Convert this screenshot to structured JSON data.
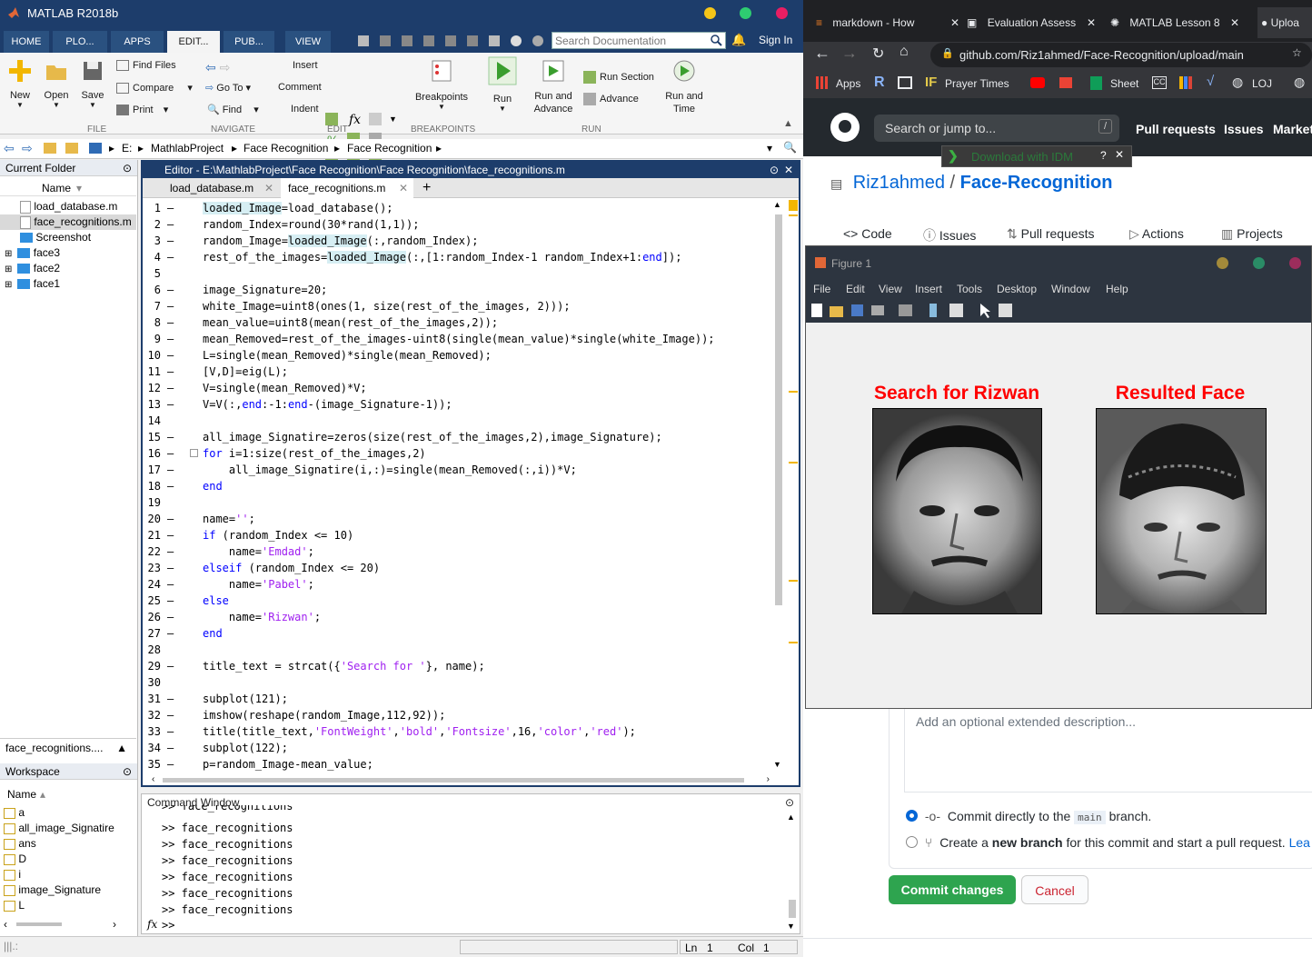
{
  "matlab": {
    "title": "MATLAB R2018b",
    "tabs": [
      "HOME",
      "PLO...",
      "APPS",
      "EDIT...",
      "PUB...",
      "VIEW"
    ],
    "search_placeholder": "Search Documentation",
    "sign_in": "Sign In",
    "ribbon": {
      "new": "New",
      "open": "Open",
      "save": "Save",
      "find_files": "Find Files",
      "compare": "Compare",
      "print": "Print",
      "go_to": "Go To",
      "find": "Find",
      "insert": "Insert",
      "comment": "Comment",
      "indent": "Indent",
      "breakpoints": "Breakpoints",
      "run": "Run",
      "run_and_advance": "Run and Advance",
      "run_section": "Run Section",
      "advance": "Advance",
      "run_and_time": "Run and Time",
      "sections": [
        "FILE",
        "NAVIGATE",
        "EDIT",
        "BREAKPOINTS",
        "RUN"
      ]
    },
    "address": [
      "E:",
      "MathlabProject",
      "Face Recognition",
      "Face Recognition"
    ],
    "current_folder": {
      "title": "Current Folder",
      "column": "Name",
      "items": [
        "load_database.m",
        "face_recognitions.m",
        "Screenshot",
        "face3",
        "face2",
        "face1"
      ],
      "footer": "face_recognitions...."
    },
    "workspace": {
      "title": "Workspace",
      "column": "Name",
      "items": [
        "a",
        "all_image_Signatire",
        "ans",
        "D",
        "i",
        "image_Signature",
        "L"
      ]
    },
    "editor": {
      "title": "Editor - E:\\MathlabProject\\Face Recognition\\Face Recognition\\face_recognitions.m",
      "tabs": [
        "load_database.m",
        "face_recognitions.m"
      ],
      "add_tab": "+"
    },
    "command_window": {
      "title": "Command Window",
      "partial_line": ">>  face_recognitions",
      "history": [
        ">> face_recognitions",
        ">> face_recognitions",
        ">> face_recognitions",
        ">> face_recognitions",
        ">> face_recognitions",
        ">> face_recognitions"
      ],
      "prompt": ">>",
      "fx": "fx"
    },
    "status": {
      "ln_label": "Ln",
      "ln": "1",
      "col_label": "Col",
      "col": "1"
    }
  },
  "chrome": {
    "tabs": [
      "markdown - How",
      "Evaluation Assess",
      "MATLAB Lesson 8",
      "Uploa"
    ],
    "url": "github.com/Riz1ahmed/Face-Recognition/upload/main",
    "bookmarks": [
      "Apps",
      "Prayer Times",
      "Sheet",
      "LOJ"
    ],
    "idm": "Download with IDM",
    "github": {
      "search_placeholder": "Search or jump to...",
      "slash": "/",
      "nav": [
        "Pull requests",
        "Issues",
        "Market"
      ],
      "owner": "Riz1ahmed",
      "sep": "/",
      "repo": "Face-Recognition",
      "repo_tabs": [
        "Code",
        "Issues",
        "Pull requests",
        "Actions",
        "Projects"
      ],
      "desc_placeholder": "Add an optional extended description...",
      "commit_direct_pre": "Commit directly to the",
      "branch": "main",
      "commit_direct_post": "branch.",
      "new_branch_pre": "Create a",
      "new_branch_bold": "new branch",
      "new_branch_post": "for this commit and start a pull request.",
      "learn": "Lea",
      "commit_button": "Commit changes",
      "cancel_button": "Cancel"
    }
  },
  "figure": {
    "title": "Figure 1",
    "menu": [
      "File",
      "Edit",
      "View",
      "Insert",
      "Tools",
      "Desktop",
      "Window",
      "Help"
    ],
    "left_title": "Search for Rizwan",
    "right_title": "Resulted Face",
    "title_color": "#ff0000"
  },
  "code_lines": [
    {
      "n": "1",
      "d": "–",
      "t": "loaded_Image=load_database();"
    },
    {
      "n": "2",
      "d": "–",
      "t": "random_Index=round(30*rand(1,1));"
    },
    {
      "n": "3",
      "d": "–",
      "t": "random_Image=loaded_Image(:,random_Index);"
    },
    {
      "n": "4",
      "d": "–",
      "t": "rest_of_the_images=loaded_Image(:,[1:random_Index-1 random_Index+1:end]);"
    },
    {
      "n": "5",
      "d": "",
      "t": ""
    },
    {
      "n": "6",
      "d": "–",
      "t": "image_Signature=20;"
    },
    {
      "n": "7",
      "d": "–",
      "t": "white_Image=uint8(ones(1, size(rest_of_the_images, 2)));"
    },
    {
      "n": "8",
      "d": "–",
      "t": "mean_value=uint8(mean(rest_of_the_images,2));"
    },
    {
      "n": "9",
      "d": "–",
      "t": "mean_Removed=rest_of_the_images-uint8(single(mean_value)*single(white_Image));"
    },
    {
      "n": "10",
      "d": "–",
      "t": "L=single(mean_Removed)'*single(mean_Removed);"
    },
    {
      "n": "11",
      "d": "–",
      "t": "[V,D]=eig(L);"
    },
    {
      "n": "12",
      "d": "–",
      "t": "V=single(mean_Removed)*V;"
    },
    {
      "n": "13",
      "d": "–",
      "t": "V=V(:,end:-1:end-(image_Signature-1));"
    },
    {
      "n": "14",
      "d": "",
      "t": ""
    },
    {
      "n": "15",
      "d": "–",
      "t": "all_image_Signatire=zeros(size(rest_of_the_images,2),image_Signature);"
    },
    {
      "n": "16",
      "d": "–",
      "t": "for i=1:size(rest_of_the_images,2)"
    },
    {
      "n": "17",
      "d": "–",
      "t": "    all_image_Signatire(i,:)=single(mean_Removed(:,i))'*V;"
    },
    {
      "n": "18",
      "d": "–",
      "t": "end"
    },
    {
      "n": "19",
      "d": "",
      "t": ""
    },
    {
      "n": "20",
      "d": "–",
      "t": "name='';"
    },
    {
      "n": "21",
      "d": "–",
      "t": "if (random_Index <= 10)"
    },
    {
      "n": "22",
      "d": "–",
      "t": "    name='Emdad';"
    },
    {
      "n": "23",
      "d": "–",
      "t": "elseif (random_Index <= 20)"
    },
    {
      "n": "24",
      "d": "–",
      "t": "    name='Pabel';"
    },
    {
      "n": "25",
      "d": "–",
      "t": "else"
    },
    {
      "n": "26",
      "d": "–",
      "t": "    name='Rizwan';"
    },
    {
      "n": "27",
      "d": "–",
      "t": "end"
    },
    {
      "n": "28",
      "d": "",
      "t": ""
    },
    {
      "n": "29",
      "d": "–",
      "t": "title_text = strcat({'Search for '}, name);"
    },
    {
      "n": "30",
      "d": "",
      "t": ""
    },
    {
      "n": "31",
      "d": "–",
      "t": "subplot(121);"
    },
    {
      "n": "32",
      "d": "–",
      "t": "imshow(reshape(random_Image,112,92));"
    },
    {
      "n": "33",
      "d": "–",
      "t": "title(title_text,'FontWeight','bold','Fontsize',16,'color','red');"
    },
    {
      "n": "34",
      "d": "–",
      "t": "subplot(122);"
    },
    {
      "n": "35",
      "d": "–",
      "t": "p=random_Image-mean_value;"
    }
  ]
}
